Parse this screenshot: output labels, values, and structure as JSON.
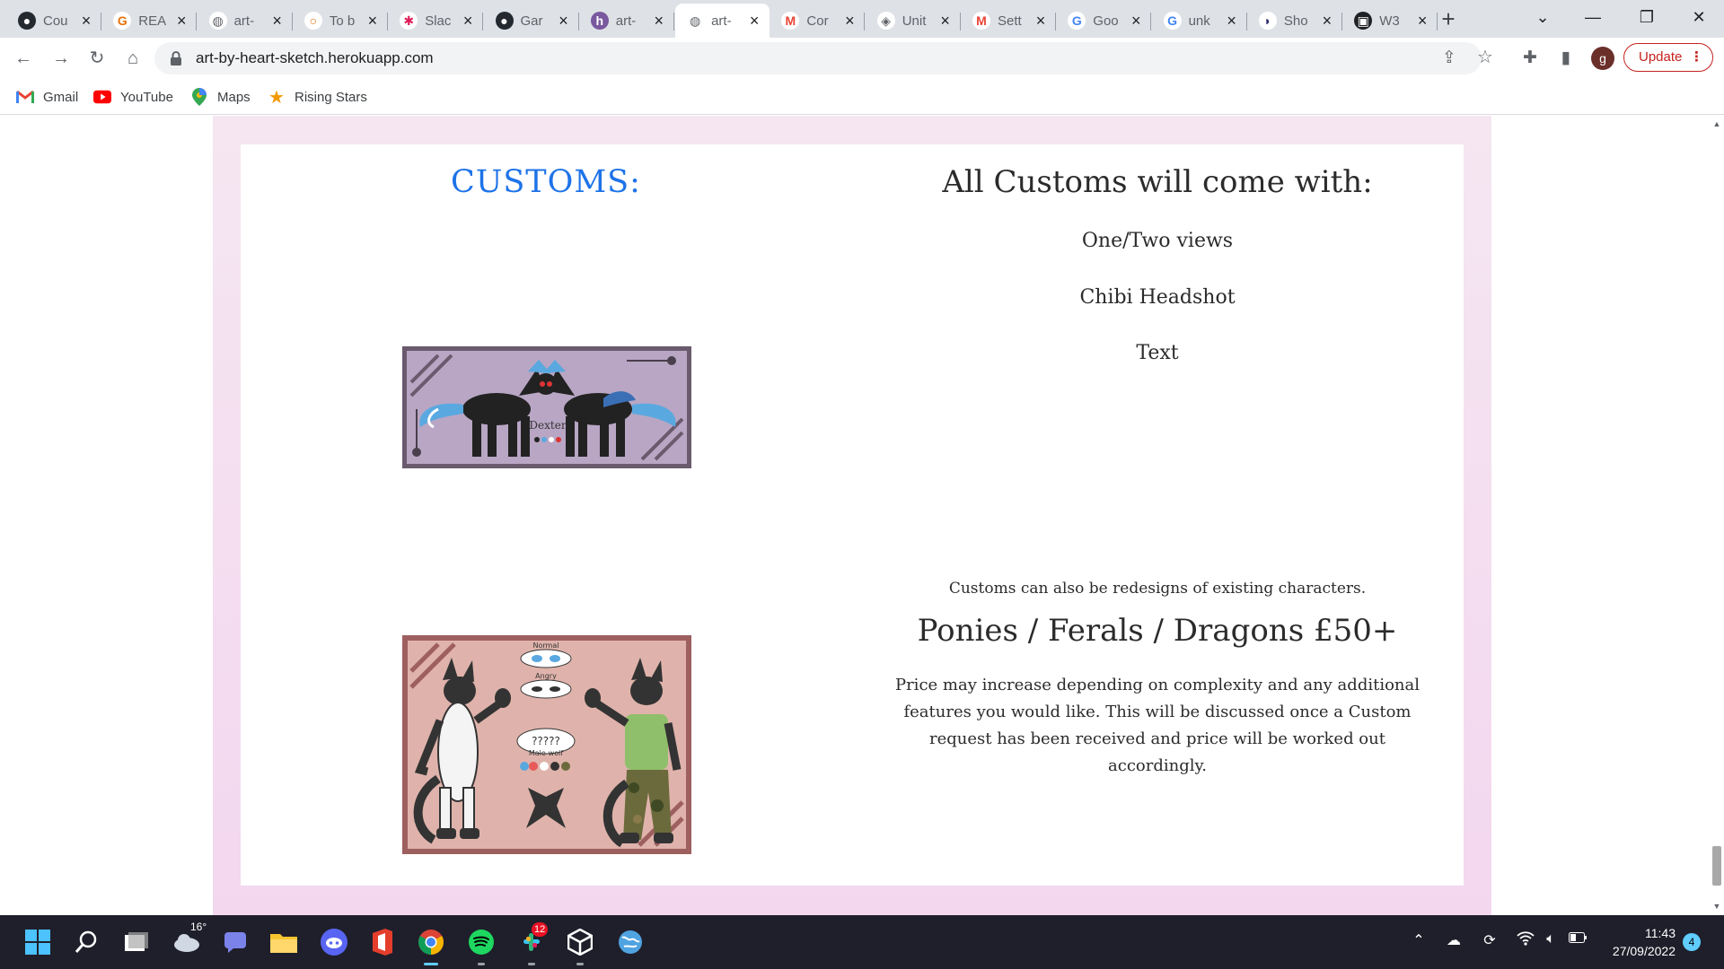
{
  "browser": {
    "tabs": [
      {
        "label": "Cou",
        "icon": "github-icon"
      },
      {
        "label": "REA",
        "icon": "grammarly-icon"
      },
      {
        "label": "art-",
        "icon": "globe-icon"
      },
      {
        "label": "To b",
        "icon": "todo-icon"
      },
      {
        "label": "Slac",
        "icon": "slack-icon"
      },
      {
        "label": "Gar",
        "icon": "github-icon"
      },
      {
        "label": "art-",
        "icon": "heroku-icon"
      },
      {
        "label": "art-",
        "icon": "globe-icon",
        "active": true
      },
      {
        "label": "Cor",
        "icon": "gmail-icon"
      },
      {
        "label": "Unit",
        "icon": "unity-icon"
      },
      {
        "label": "Sett",
        "icon": "gmail-icon"
      },
      {
        "label": "Goo",
        "icon": "google-icon"
      },
      {
        "label": "unk",
        "icon": "google-icon"
      },
      {
        "label": "Sho",
        "icon": "shop-icon"
      },
      {
        "label": "W3",
        "icon": "w3-icon"
      }
    ],
    "url": "art-by-heart-sketch.herokuapp.com",
    "profile_initial": "g",
    "update_label": "Update",
    "bookmarks": [
      {
        "label": "Gmail",
        "icon": "gmail-icon"
      },
      {
        "label": "YouTube",
        "icon": "youtube-icon"
      },
      {
        "label": "Maps",
        "icon": "maps-icon"
      },
      {
        "label": "Rising Stars",
        "icon": "star-icon"
      }
    ]
  },
  "page": {
    "customs_heading": "CUSTOMS:",
    "includes_heading": "All Customs will come with:",
    "includes": [
      "One/Two views",
      "Chibi Headshot",
      "Text"
    ],
    "redesign_note": "Customs can also be redesigns of existing characters.",
    "price_heading": "Ponies / Ferals / Dragons £50+",
    "price_description": "Price may increase depending on complexity and any additional features you would like. This will be discussed once a Custom request has been received and price will be worked out accordingly.",
    "image1_text": "Dexter",
    "image2_labels": [
      "Normal",
      "Angry",
      "?????",
      "Male-wolf"
    ]
  },
  "taskbar": {
    "weather_temp": "16°",
    "slack_badge": "12",
    "time": "11:43",
    "date": "27/09/2022",
    "notification_count": "4"
  },
  "colors": {
    "heading_blue": "#1e73e8",
    "page_pink": "#f3d7ef",
    "update_red": "#c5221f"
  }
}
